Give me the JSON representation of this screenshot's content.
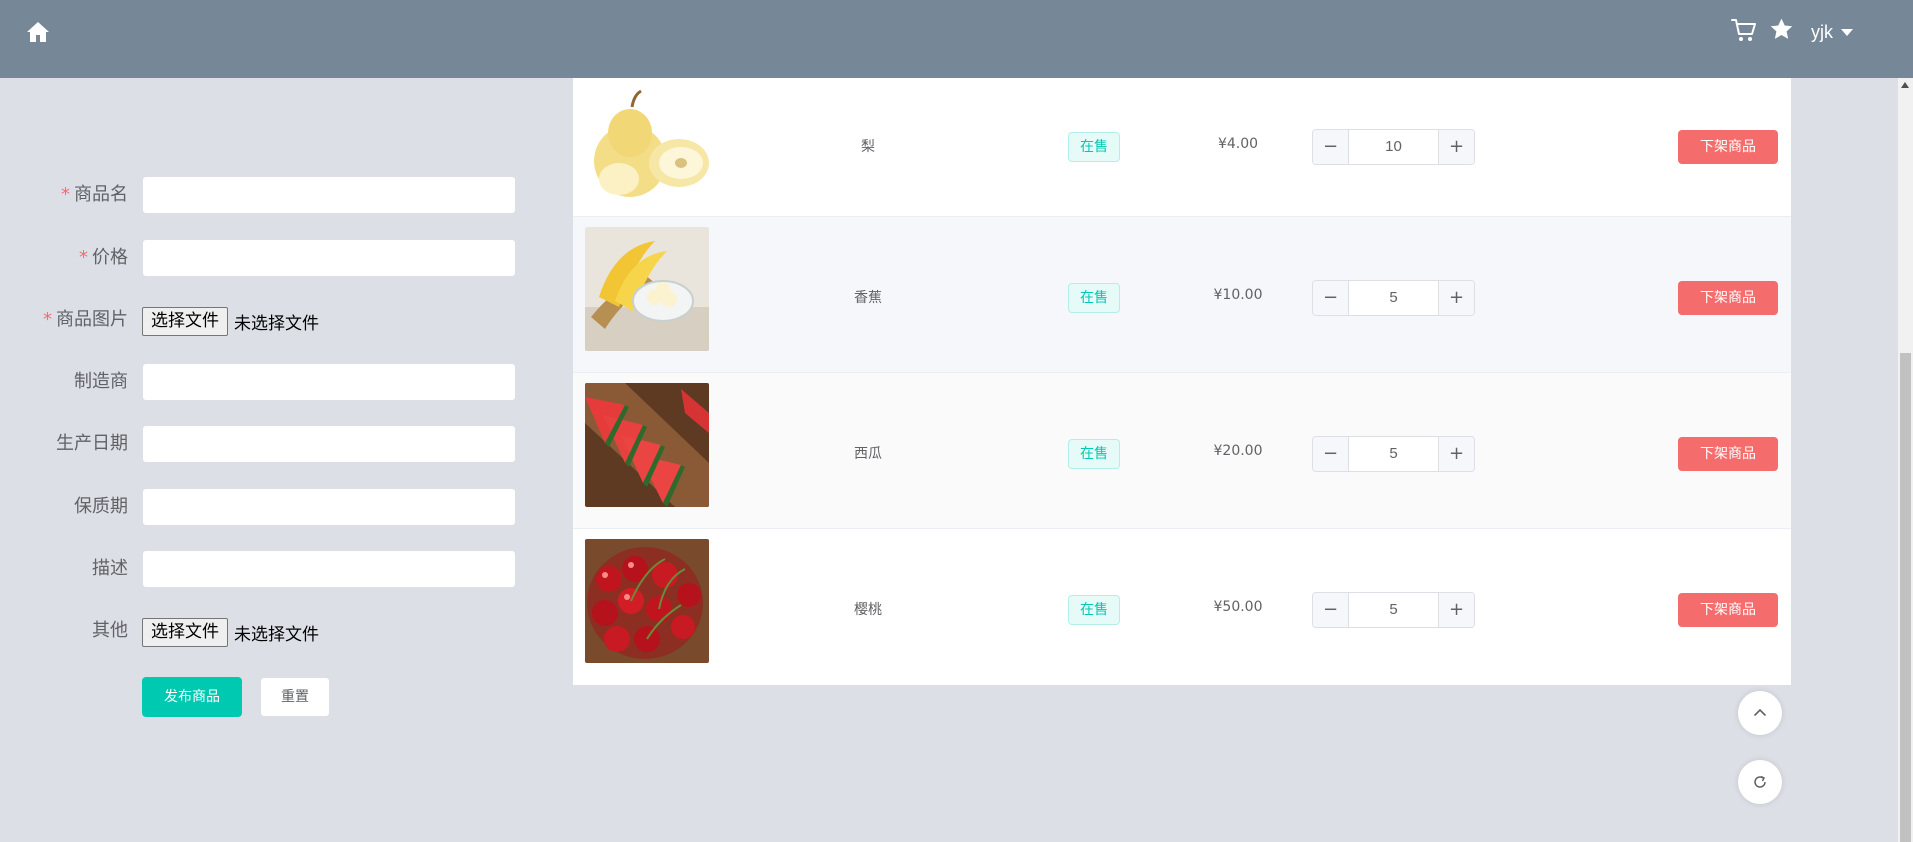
{
  "header": {
    "icons": {
      "home": "home-icon",
      "cart": "cart-icon",
      "favorites": "star-icon"
    },
    "username": "yjk"
  },
  "form": {
    "fields": [
      {
        "label": "商品名",
        "required": true,
        "type": "text",
        "value": ""
      },
      {
        "label": "价格",
        "required": true,
        "type": "text",
        "value": ""
      },
      {
        "label": "商品图片",
        "required": true,
        "type": "file",
        "button": "选择文件",
        "status": "未选择文件"
      },
      {
        "label": "制造商",
        "required": false,
        "type": "text",
        "value": ""
      },
      {
        "label": "生产日期",
        "required": false,
        "type": "text",
        "value": ""
      },
      {
        "label": "保质期",
        "required": false,
        "type": "text",
        "value": ""
      },
      {
        "label": "描述",
        "required": false,
        "type": "text",
        "value": ""
      },
      {
        "label": "其他",
        "required": false,
        "type": "file",
        "button": "选择文件",
        "status": "未选择文件"
      }
    ],
    "required_mark": "*",
    "submit_label": "发布商品",
    "reset_label": "重置"
  },
  "products": [
    {
      "name": "梨",
      "status": "在售",
      "price": "¥4.00",
      "quantity": "10",
      "action": "下架商品",
      "image": "pear"
    },
    {
      "name": "香蕉",
      "status": "在售",
      "price": "¥10.00",
      "quantity": "5",
      "action": "下架商品",
      "image": "banana"
    },
    {
      "name": "西瓜",
      "status": "在售",
      "price": "¥20.00",
      "quantity": "5",
      "action": "下架商品",
      "image": "watermelon"
    },
    {
      "name": "樱桃",
      "status": "在售",
      "price": "¥50.00",
      "quantity": "5",
      "action": "下架商品",
      "image": "cherry"
    }
  ],
  "stepper": {
    "minus": "−",
    "plus": "+"
  },
  "colors": {
    "header": "#768797",
    "page_bg": "#dcdfe6",
    "primary": "#00c9b2",
    "danger": "#f56c6c",
    "required": "#f56c6c"
  },
  "floating": {
    "back_to_top": "chevron-up-icon",
    "refresh": "refresh-icon"
  }
}
